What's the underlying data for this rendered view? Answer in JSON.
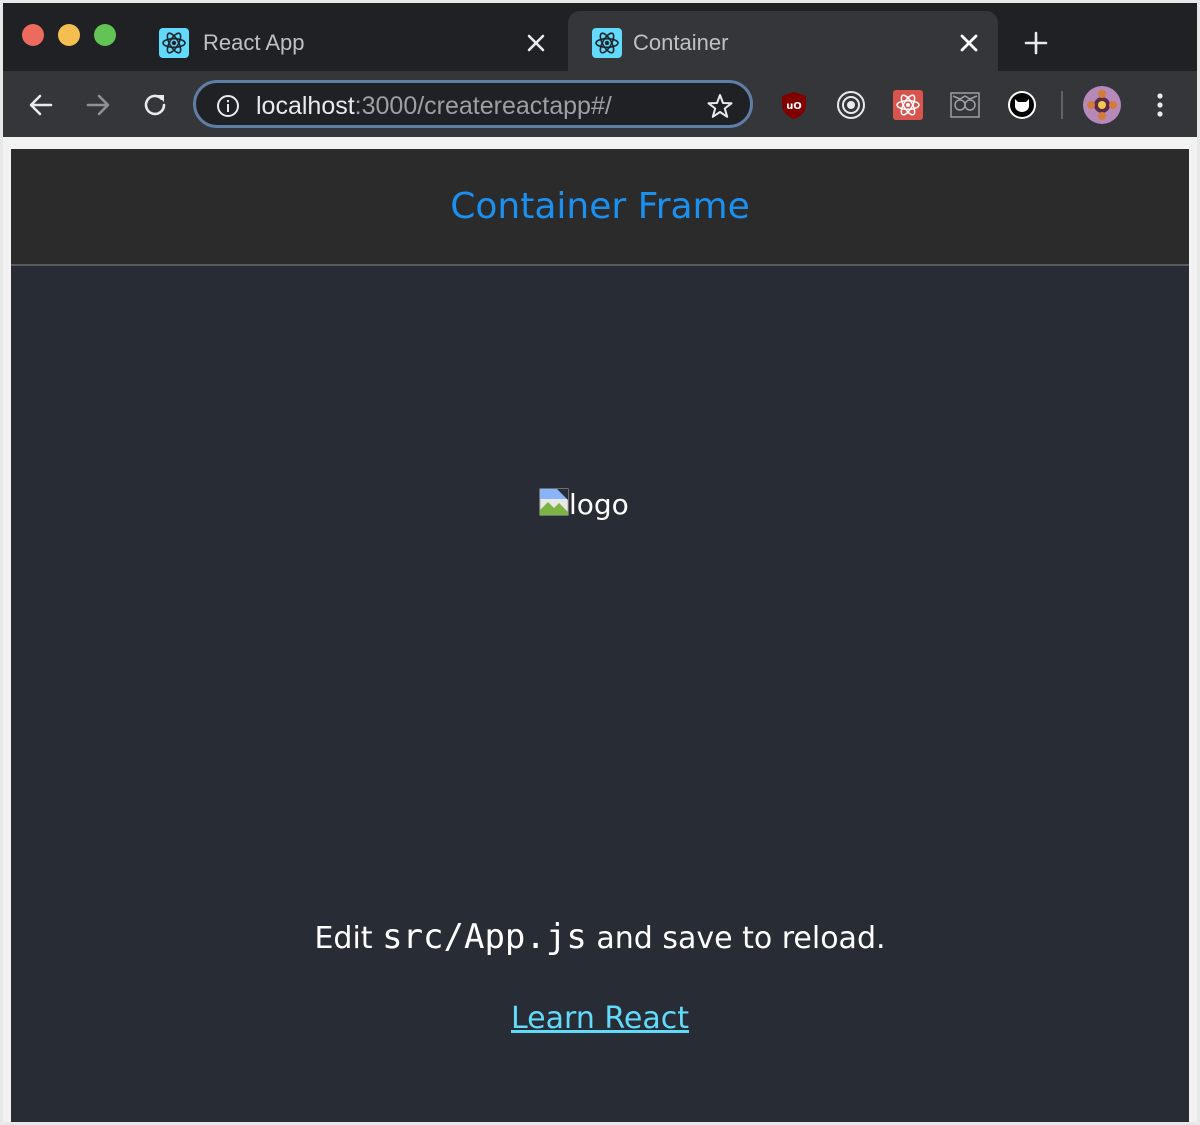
{
  "browser": {
    "tabs": [
      {
        "title": "React App",
        "active": false
      },
      {
        "title": "Container",
        "active": true
      }
    ],
    "address": {
      "host": "localhost",
      "rest": ":3000/createreactapp#/"
    }
  },
  "page": {
    "header_title": "Container Frame",
    "logo_alt": "logo",
    "edit_prefix": "Edit ",
    "edit_code": "src/App.js",
    "edit_suffix": " and save to reload.",
    "learn_link": "Learn React"
  },
  "colors": {
    "header_title": "#1a90f0",
    "link": "#61dafb",
    "app_bg": "#282c34"
  }
}
